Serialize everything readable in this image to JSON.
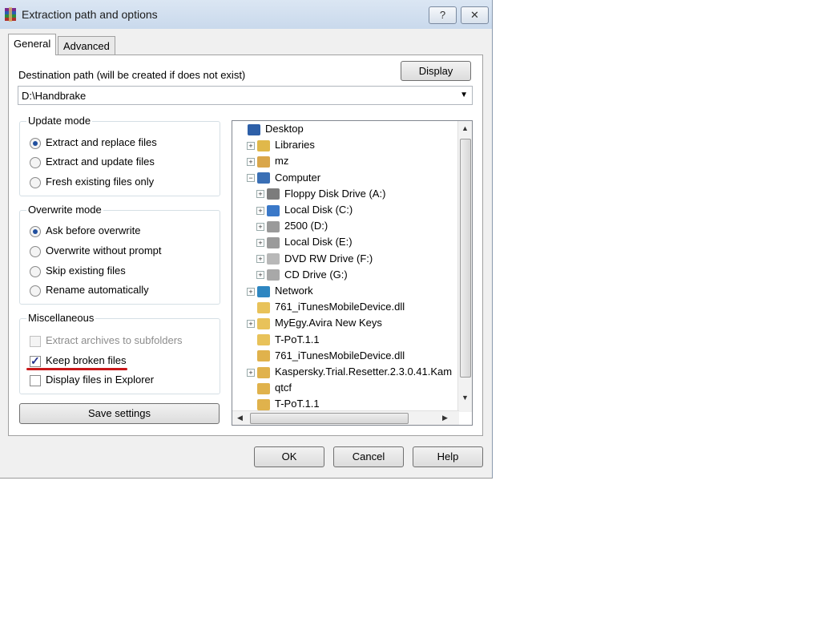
{
  "window": {
    "title": "Extraction path and options",
    "help_button": "?",
    "close_button": "✕"
  },
  "tabs": [
    {
      "label": "General"
    },
    {
      "label": "Advanced"
    }
  ],
  "destination": {
    "label": "Destination path (will be created if does not exist)",
    "value": "D:\\Handbrake",
    "display_button": "Display"
  },
  "update_mode": {
    "title": "Update mode",
    "options": [
      {
        "label": "Extract and replace files",
        "selected": true
      },
      {
        "label": "Extract and update files",
        "selected": false
      },
      {
        "label": "Fresh existing files only",
        "selected": false
      }
    ]
  },
  "overwrite_mode": {
    "title": "Overwrite mode",
    "options": [
      {
        "label": "Ask before overwrite",
        "selected": true
      },
      {
        "label": "Overwrite without prompt",
        "selected": false
      },
      {
        "label": "Skip existing files",
        "selected": false
      },
      {
        "label": "Rename automatically",
        "selected": false
      }
    ]
  },
  "misc": {
    "title": "Miscellaneous",
    "options": [
      {
        "label": "Extract archives to subfolders",
        "checked": false,
        "disabled": true
      },
      {
        "label": "Keep broken files",
        "checked": true,
        "disabled": false
      },
      {
        "label": "Display files in Explorer",
        "checked": false,
        "disabled": false
      }
    ]
  },
  "save_settings_button": "Save settings",
  "tree": {
    "items": [
      {
        "label": "Desktop",
        "icon": "desktop-icon",
        "level": 0,
        "expander": ""
      },
      {
        "label": "Libraries",
        "icon": "libraries-icon",
        "level": 1,
        "expander": "+"
      },
      {
        "label": "mz",
        "icon": "user-folder-icon",
        "level": 1,
        "expander": "+"
      },
      {
        "label": "Computer",
        "icon": "computer-icon",
        "level": 1,
        "expander": "−"
      },
      {
        "label": "Floppy Disk Drive (A:)",
        "icon": "floppy-icon",
        "level": 2,
        "expander": "+"
      },
      {
        "label": "Local Disk (C:)",
        "icon": "windows-drive-icon",
        "level": 2,
        "expander": "+"
      },
      {
        "label": "2500 (D:)",
        "icon": "drive-icon",
        "level": 2,
        "expander": "+"
      },
      {
        "label": "Local Disk (E:)",
        "icon": "drive-icon",
        "level": 2,
        "expander": "+"
      },
      {
        "label": "DVD RW Drive (F:)",
        "icon": "dvd-icon",
        "level": 2,
        "expander": "+"
      },
      {
        "label": "CD Drive (G:)",
        "icon": "cd-icon",
        "level": 2,
        "expander": "+"
      },
      {
        "label": "Network",
        "icon": "network-icon",
        "level": 1,
        "expander": "+"
      },
      {
        "label": "761_iTunesMobileDevice.dll",
        "icon": "folder-icon",
        "level": 1,
        "expander": ""
      },
      {
        "label": "MyEgy.Avira New Keys",
        "icon": "folder-icon",
        "level": 1,
        "expander": "+"
      },
      {
        "label": "T-PoT.1.1",
        "icon": "folder-icon",
        "level": 1,
        "expander": ""
      },
      {
        "label": "761_iTunesMobileDevice.dll",
        "icon": "zip-folder-icon",
        "level": 1,
        "expander": ""
      },
      {
        "label": "Kaspersky.Trial.Resetter.2.3.0.41.Kam",
        "icon": "zip-folder-icon",
        "level": 1,
        "expander": "+"
      },
      {
        "label": "qtcf",
        "icon": "zip-folder-icon",
        "level": 1,
        "expander": ""
      },
      {
        "label": "T-PoT.1.1",
        "icon": "zip-folder-icon",
        "level": 1,
        "expander": ""
      }
    ]
  },
  "footer": {
    "ok": "OK",
    "cancel": "Cancel",
    "help": "Help"
  },
  "colors": {
    "accent": "#214f9e",
    "annotation": "#c8181a"
  }
}
